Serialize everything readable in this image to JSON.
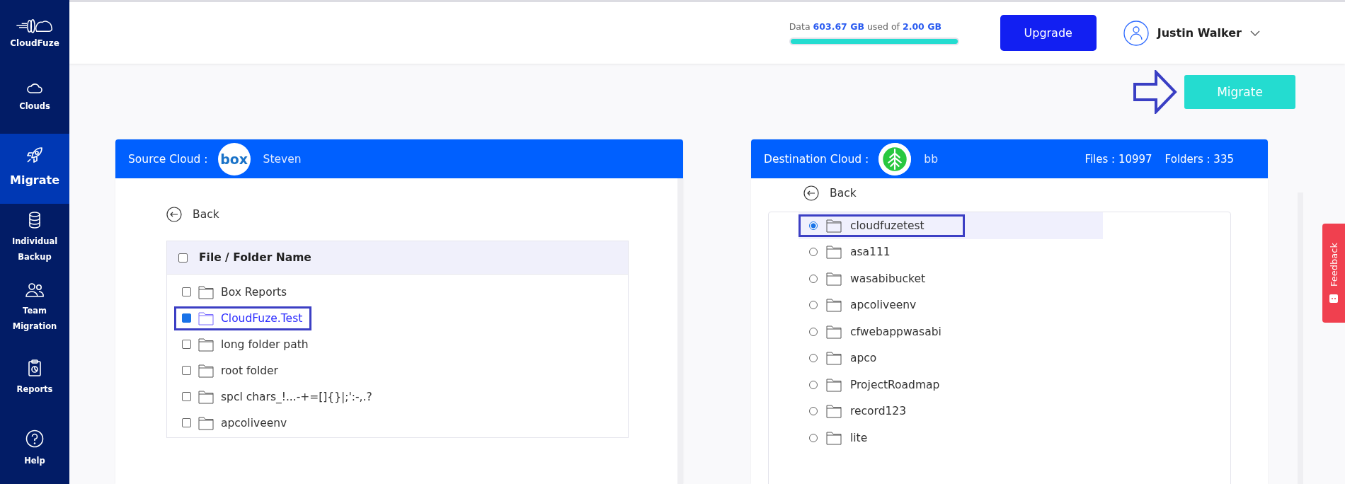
{
  "sidebar": {
    "brand": "CloudFuze",
    "items": [
      {
        "label": "Clouds",
        "selected": false
      },
      {
        "label": "Migrate",
        "selected": true
      },
      {
        "label": "Individual Backup",
        "selected": false
      },
      {
        "label": "Team Migration",
        "selected": false
      },
      {
        "label": "Reports",
        "selected": false
      },
      {
        "label": "Help",
        "selected": false
      }
    ]
  },
  "header": {
    "usage": {
      "text": "Data **603.67 GB** used of **2.00 GB**",
      "level": 1
    },
    "upgrade": "Upgrade",
    "user": "Justin Walker"
  },
  "migrate_button": "Migrate",
  "source": {
    "title": "Source Cloud :",
    "logo_text": "box",
    "account": "Steven",
    "back": "Back",
    "column": "File / Folder Name",
    "select_all": false,
    "rows": [
      {
        "name": "Box Reports",
        "checked": false,
        "annotated": false
      },
      {
        "name": "CloudFuze.Test",
        "checked": true,
        "annotated": true
      },
      {
        "name": "long folder path",
        "checked": false,
        "annotated": false
      },
      {
        "name": "root folder",
        "checked": false,
        "annotated": false
      },
      {
        "name": "spcl chars_!...-+=[]{}|;':-,.?",
        "checked": false,
        "annotated": false
      },
      {
        "name": "apcoliveenv",
        "checked": false,
        "annotated": false
      }
    ]
  },
  "destination": {
    "title": "Destination Cloud :",
    "account": "bb",
    "files": "Files : 10997",
    "folders": "Folders : 335",
    "back": "Back",
    "rows": [
      {
        "name": "cloudfuzetest",
        "selected": true,
        "annotated": true
      },
      {
        "name": "asa111",
        "selected": false,
        "annotated": false
      },
      {
        "name": "wasabibucket",
        "selected": false,
        "annotated": false
      },
      {
        "name": "apcoliveenv",
        "selected": false,
        "annotated": false
      },
      {
        "name": "cfwebappwasabi",
        "selected": false,
        "annotated": false
      },
      {
        "name": "apco",
        "selected": false,
        "annotated": false
      },
      {
        "name": "ProjectRoadmap",
        "selected": false,
        "annotated": false
      },
      {
        "name": "record123",
        "selected": false,
        "annotated": false
      },
      {
        "name": "lite",
        "selected": false,
        "annotated": false
      }
    ]
  },
  "feedback": "Feedback"
}
